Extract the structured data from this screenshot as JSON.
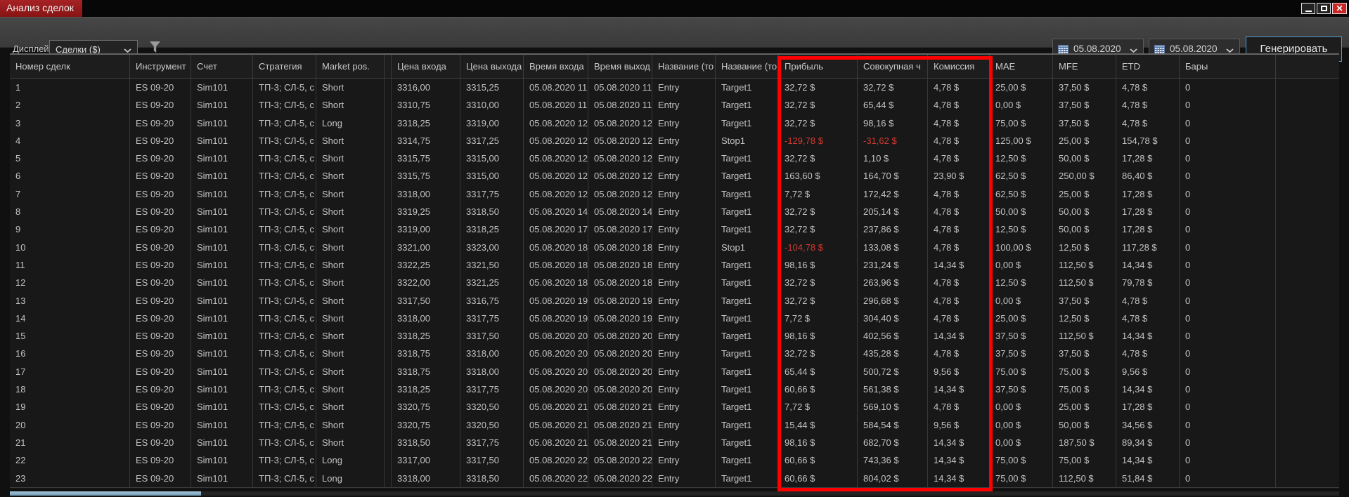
{
  "window": {
    "title": "Анализ сделок"
  },
  "toolbar": {
    "display_label": "Дисплей",
    "display_value": "Сделки ($)",
    "date_from": "05.08.2020",
    "date_to": "05.08.2020",
    "generate_label": "Генерировать"
  },
  "annotation": {
    "highlighted_columns": [
      "Прибыль",
      "Совокупная ч",
      "Комиссия"
    ],
    "color": "#ff0000"
  },
  "colors": {
    "title_tab": "#9c1d1d",
    "accent_border": "#4f9bd5",
    "negative_value": "#cf3a32",
    "annotation": "#ff0000"
  },
  "table": {
    "columns": [
      {
        "label": "Номер сделк"
      },
      {
        "label": "Инструмент"
      },
      {
        "label": "Счет"
      },
      {
        "label": "Стратегия"
      },
      {
        "label": "Market pos."
      },
      {
        "label": ""
      },
      {
        "label": "Цена входа"
      },
      {
        "label": "Цена выхода"
      },
      {
        "label": "Время входа"
      },
      {
        "label": "Время выход"
      },
      {
        "label": "Название (то"
      },
      {
        "label": "Название (то"
      },
      {
        "label": "Прибыль"
      },
      {
        "label": "Совокупная ч"
      },
      {
        "label": "Комиссия"
      },
      {
        "label": "MAE"
      },
      {
        "label": "MFE"
      },
      {
        "label": "ETD"
      },
      {
        "label": "Бары"
      }
    ],
    "rows": [
      [
        "1",
        "ES 09-20",
        "Sim101",
        "ТП-3; СЛ-5, с",
        "Short",
        "",
        "3316,00",
        "3315,25",
        "05.08.2020 11",
        "05.08.2020 11",
        "Entry",
        "Target1",
        "32,72 $",
        "32,72 $",
        "4,78 $",
        "25,00 $",
        "37,50 $",
        "4,78 $",
        "0"
      ],
      [
        "2",
        "ES 09-20",
        "Sim101",
        "ТП-3; СЛ-5, с",
        "Short",
        "",
        "3310,75",
        "3310,00",
        "05.08.2020 11",
        "05.08.2020 11",
        "Entry",
        "Target1",
        "32,72 $",
        "65,44 $",
        "4,78 $",
        "0,00 $",
        "37,50 $",
        "4,78 $",
        "0"
      ],
      [
        "3",
        "ES 09-20",
        "Sim101",
        "ТП-3; СЛ-5, с",
        "Long",
        "",
        "3318,25",
        "3319,00",
        "05.08.2020 12",
        "05.08.2020 12",
        "Entry",
        "Target1",
        "32,72 $",
        "98,16 $",
        "4,78 $",
        "75,00 $",
        "37,50 $",
        "4,78 $",
        "0"
      ],
      [
        "4",
        "ES 09-20",
        "Sim101",
        "ТП-3; СЛ-5, с",
        "Short",
        "",
        "3314,75",
        "3317,25",
        "05.08.2020 12",
        "05.08.2020 12",
        "Entry",
        "Stop1",
        "-129,78 $",
        "-31,62 $",
        "4,78 $",
        "125,00 $",
        "25,00 $",
        "154,78 $",
        "0"
      ],
      [
        "5",
        "ES 09-20",
        "Sim101",
        "ТП-3; СЛ-5, с",
        "Short",
        "",
        "3315,75",
        "3315,00",
        "05.08.2020 12",
        "05.08.2020 12",
        "Entry",
        "Target1",
        "32,72 $",
        "1,10 $",
        "4,78 $",
        "12,50 $",
        "50,00 $",
        "17,28 $",
        "0"
      ],
      [
        "6",
        "ES 09-20",
        "Sim101",
        "ТП-3; СЛ-5, с",
        "Short",
        "",
        "3315,75",
        "3315,00",
        "05.08.2020 12",
        "05.08.2020 12",
        "Entry",
        "Target1",
        "163,60 $",
        "164,70 $",
        "23,90 $",
        "62,50 $",
        "250,00 $",
        "86,40 $",
        "0"
      ],
      [
        "7",
        "ES 09-20",
        "Sim101",
        "ТП-3; СЛ-5, с",
        "Short",
        "",
        "3318,00",
        "3317,75",
        "05.08.2020 12",
        "05.08.2020 12",
        "Entry",
        "Target1",
        "7,72 $",
        "172,42 $",
        "4,78 $",
        "62,50 $",
        "25,00 $",
        "17,28 $",
        "0"
      ],
      [
        "8",
        "ES 09-20",
        "Sim101",
        "ТП-3; СЛ-5, с",
        "Short",
        "",
        "3319,25",
        "3318,50",
        "05.08.2020 14",
        "05.08.2020 14",
        "Entry",
        "Target1",
        "32,72 $",
        "205,14 $",
        "4,78 $",
        "50,00 $",
        "50,00 $",
        "17,28 $",
        "0"
      ],
      [
        "9",
        "ES 09-20",
        "Sim101",
        "ТП-3; СЛ-5, с",
        "Short",
        "",
        "3319,00",
        "3318,25",
        "05.08.2020 17",
        "05.08.2020 17",
        "Entry",
        "Target1",
        "32,72 $",
        "237,86 $",
        "4,78 $",
        "12,50 $",
        "50,00 $",
        "17,28 $",
        "0"
      ],
      [
        "10",
        "ES 09-20",
        "Sim101",
        "ТП-3; СЛ-5, с",
        "Short",
        "",
        "3321,00",
        "3323,00",
        "05.08.2020 18",
        "05.08.2020 18",
        "Entry",
        "Stop1",
        "-104,78 $",
        "133,08 $",
        "4,78 $",
        "100,00 $",
        "12,50 $",
        "117,28 $",
        "0"
      ],
      [
        "11",
        "ES 09-20",
        "Sim101",
        "ТП-3; СЛ-5, с",
        "Short",
        "",
        "3322,25",
        "3321,50",
        "05.08.2020 18",
        "05.08.2020 18",
        "Entry",
        "Target1",
        "98,16 $",
        "231,24 $",
        "14,34 $",
        "0,00 $",
        "112,50 $",
        "14,34 $",
        "0"
      ],
      [
        "12",
        "ES 09-20",
        "Sim101",
        "ТП-3; СЛ-5, с",
        "Short",
        "",
        "3322,00",
        "3321,25",
        "05.08.2020 18",
        "05.08.2020 18",
        "Entry",
        "Target1",
        "32,72 $",
        "263,96 $",
        "4,78 $",
        "12,50 $",
        "112,50 $",
        "79,78 $",
        "0"
      ],
      [
        "13",
        "ES 09-20",
        "Sim101",
        "ТП-3; СЛ-5, с",
        "Short",
        "",
        "3317,50",
        "3316,75",
        "05.08.2020 19",
        "05.08.2020 19",
        "Entry",
        "Target1",
        "32,72 $",
        "296,68 $",
        "4,78 $",
        "0,00 $",
        "37,50 $",
        "4,78 $",
        "0"
      ],
      [
        "14",
        "ES 09-20",
        "Sim101",
        "ТП-3; СЛ-5, с",
        "Short",
        "",
        "3318,00",
        "3317,75",
        "05.08.2020 19",
        "05.08.2020 19",
        "Entry",
        "Target1",
        "7,72 $",
        "304,40 $",
        "4,78 $",
        "25,00 $",
        "12,50 $",
        "4,78 $",
        "0"
      ],
      [
        "15",
        "ES 09-20",
        "Sim101",
        "ТП-3; СЛ-5, с",
        "Short",
        "",
        "3318,25",
        "3317,50",
        "05.08.2020 20",
        "05.08.2020 20",
        "Entry",
        "Target1",
        "98,16 $",
        "402,56 $",
        "14,34 $",
        "37,50 $",
        "112,50 $",
        "14,34 $",
        "0"
      ],
      [
        "16",
        "ES 09-20",
        "Sim101",
        "ТП-3; СЛ-5, с",
        "Short",
        "",
        "3318,75",
        "3318,00",
        "05.08.2020 20",
        "05.08.2020 20",
        "Entry",
        "Target1",
        "32,72 $",
        "435,28 $",
        "4,78 $",
        "37,50 $",
        "37,50 $",
        "4,78 $",
        "0"
      ],
      [
        "17",
        "ES 09-20",
        "Sim101",
        "ТП-3; СЛ-5, с",
        "Short",
        "",
        "3318,75",
        "3318,00",
        "05.08.2020 20",
        "05.08.2020 20",
        "Entry",
        "Target1",
        "65,44 $",
        "500,72 $",
        "9,56 $",
        "75,00 $",
        "75,00 $",
        "9,56 $",
        "0"
      ],
      [
        "18",
        "ES 09-20",
        "Sim101",
        "ТП-3; СЛ-5, с",
        "Short",
        "",
        "3318,25",
        "3317,75",
        "05.08.2020 20",
        "05.08.2020 20",
        "Entry",
        "Target1",
        "60,66 $",
        "561,38 $",
        "14,34 $",
        "37,50 $",
        "75,00 $",
        "14,34 $",
        "0"
      ],
      [
        "19",
        "ES 09-20",
        "Sim101",
        "ТП-3; СЛ-5, с",
        "Short",
        "",
        "3320,75",
        "3320,50",
        "05.08.2020 21",
        "05.08.2020 21",
        "Entry",
        "Target1",
        "7,72 $",
        "569,10 $",
        "4,78 $",
        "0,00 $",
        "25,00 $",
        "17,28 $",
        "0"
      ],
      [
        "20",
        "ES 09-20",
        "Sim101",
        "ТП-3; СЛ-5, с",
        "Short",
        "",
        "3320,75",
        "3320,50",
        "05.08.2020 21",
        "05.08.2020 21",
        "Entry",
        "Target1",
        "15,44 $",
        "584,54 $",
        "9,56 $",
        "0,00 $",
        "50,00 $",
        "34,56 $",
        "0"
      ],
      [
        "21",
        "ES 09-20",
        "Sim101",
        "ТП-3; СЛ-5, с",
        "Short",
        "",
        "3318,50",
        "3317,75",
        "05.08.2020 21",
        "05.08.2020 21",
        "Entry",
        "Target1",
        "98,16 $",
        "682,70 $",
        "14,34 $",
        "0,00 $",
        "187,50 $",
        "89,34 $",
        "0"
      ],
      [
        "22",
        "ES 09-20",
        "Sim101",
        "ТП-3; СЛ-5, с",
        "Long",
        "",
        "3317,00",
        "3317,50",
        "05.08.2020 22",
        "05.08.2020 22",
        "Entry",
        "Target1",
        "60,66 $",
        "743,36 $",
        "14,34 $",
        "75,00 $",
        "75,00 $",
        "14,34 $",
        "0"
      ],
      [
        "23",
        "ES 09-20",
        "Sim101",
        "ТП-3; СЛ-5, с",
        "Long",
        "",
        "3318,00",
        "3318,50",
        "05.08.2020 22",
        "05.08.2020 22",
        "Entry",
        "Target1",
        "60,66 $",
        "804,02 $",
        "14,34 $",
        "75,00 $",
        "112,50 $",
        "51,84 $",
        "0"
      ]
    ]
  }
}
